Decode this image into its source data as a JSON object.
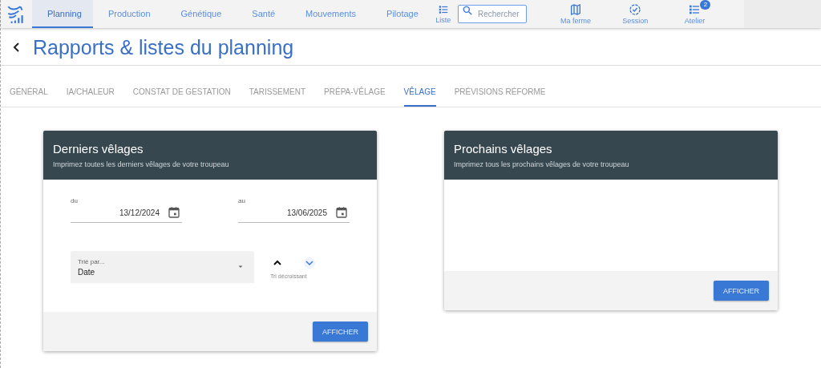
{
  "nav": {
    "items": [
      {
        "label": "Planning",
        "selected": true
      },
      {
        "label": "Production",
        "selected": false
      },
      {
        "label": "Génétique",
        "selected": false
      },
      {
        "label": "Santé",
        "selected": false
      },
      {
        "label": "Mouvements",
        "selected": false
      },
      {
        "label": "Pilotage",
        "selected": false
      }
    ],
    "list_button": "Liste",
    "search": {
      "placeholder": "Rechercher"
    },
    "actions": [
      {
        "kind": "map",
        "label": "Ma ferme"
      },
      {
        "kind": "session",
        "label": "Session"
      },
      {
        "kind": "list",
        "label": "Atelier",
        "badge": "2"
      }
    ]
  },
  "page": {
    "title": "Rapports & listes du planning"
  },
  "tabs": [
    {
      "label": "GÉNÉRAL",
      "selected": false
    },
    {
      "label": "IA/CHALEUR",
      "selected": false
    },
    {
      "label": "CONSTAT DE GESTATION",
      "selected": false
    },
    {
      "label": "TARISSEMENT",
      "selected": false
    },
    {
      "label": "PRÉPA-VÊLAGE",
      "selected": false
    },
    {
      "label": "VÊLAGE",
      "selected": true
    },
    {
      "label": "PRÉVISIONS RÉFORME",
      "selected": false
    }
  ],
  "cards": [
    {
      "title": "Derniers vêlages",
      "subtitle": "Imprimez toutes les derniers vêlages de votre troupeau",
      "dates": [
        {
          "label": "du",
          "value": "13/12/2024"
        },
        {
          "label": "au",
          "value": "13/06/2025"
        }
      ],
      "sort": {
        "label": "Trié par...",
        "value": "Date"
      },
      "sort_order": [
        {
          "kind": "up",
          "selected": false
        },
        {
          "kind": "down",
          "selected": true
        }
      ],
      "sort_order_label": "Tri décroissant",
      "button": "AFFICHER"
    },
    {
      "title": "Prochains vêlages",
      "subtitle": "Imprimez tous les prochains vêlages de votre troupeau",
      "button": "AFFICHER"
    }
  ]
}
